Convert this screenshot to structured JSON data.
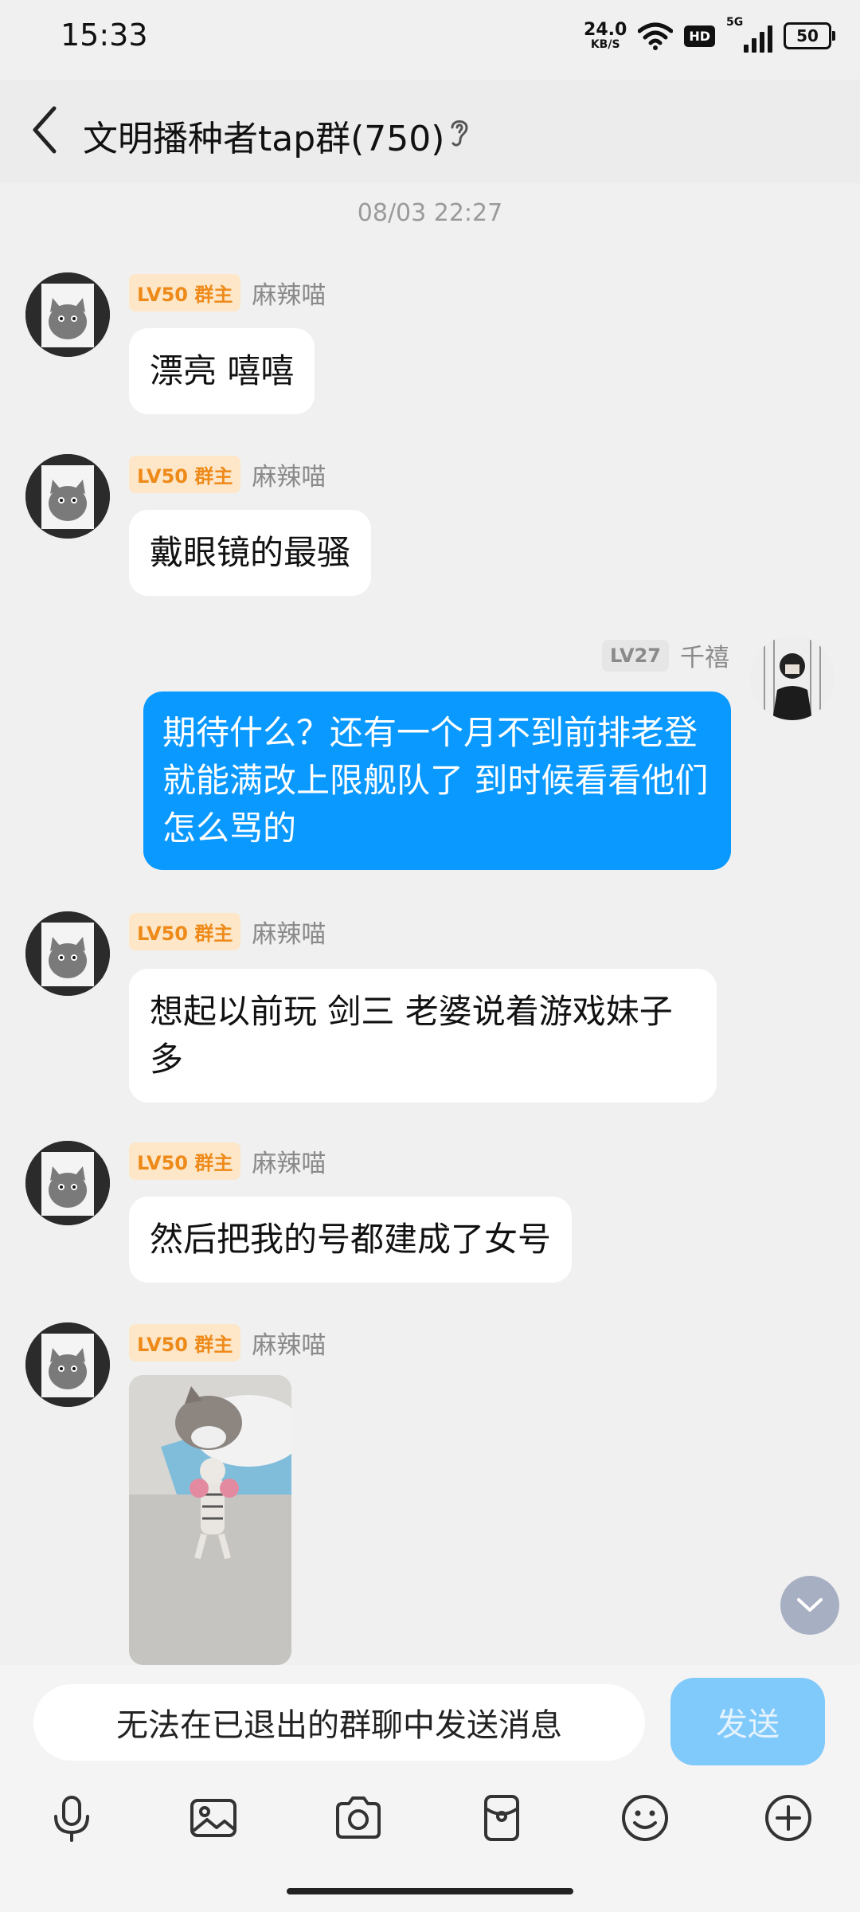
{
  "status_bar": {
    "time": "15:33",
    "net_speed_value": "24.0",
    "net_speed_unit": "KB/S",
    "hd_label": "HD",
    "network_label": "5G",
    "battery_level": "50"
  },
  "header": {
    "title": "文明播种者tap群(750)"
  },
  "chat": {
    "timestamp": "08/03 22:27",
    "messages": [
      {
        "level": "LV50 群主",
        "sender": "麻辣喵",
        "text": "漂亮 嘻嘻"
      },
      {
        "level": "LV50 群主",
        "sender": "麻辣喵",
        "text": "戴眼镜的最骚"
      },
      {
        "level": "LV27",
        "sender": "千禧",
        "text": "期待什么？还有一个月不到前排老登就能满改上限舰队了 到时候看看他们怎么骂的"
      },
      {
        "level": "LV50 群主",
        "sender": "麻辣喵",
        "text": "想起以前玩 剑三 老婆说着游戏妹子多"
      },
      {
        "level": "LV50 群主",
        "sender": "麻辣喵",
        "text": "然后把我的号都建成了女号"
      },
      {
        "level": "LV50 群主",
        "sender": "麻辣喵",
        "text": ""
      }
    ]
  },
  "input": {
    "disabled_message": "无法在已退出的群聊中发送消息",
    "send_label": "发送"
  },
  "toolbar": {
    "icons": [
      "microphone-icon",
      "image-icon",
      "camera-icon",
      "red-packet-icon",
      "emoji-icon",
      "plus-icon"
    ]
  },
  "colors": {
    "self_bubble": "#0a99ff",
    "badge_owner_bg": "#fde7c8",
    "badge_owner_text": "#ee8a1a",
    "send_button": "#80c9fb"
  }
}
